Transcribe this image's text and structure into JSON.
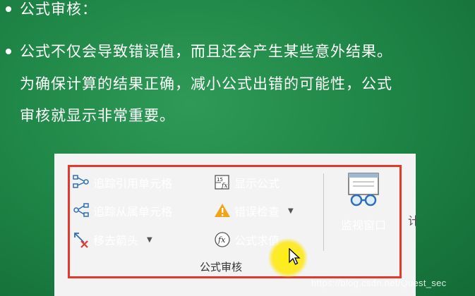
{
  "slide": {
    "bullet1": "公式审核：",
    "bullet2_line1": "公式不仅会导致错误值，而且还会产生某些意外结果。",
    "para_line2": "为确保计算的结果正确，减小公式出错的可能性，公式",
    "para_line3": "审核就显示非常重要。"
  },
  "ribbon": {
    "trace_precedents": "追踪引用单元格",
    "trace_dependents": "追踪从属单元格",
    "remove_arrows": "移去箭头",
    "show_formulas": "显示公式",
    "error_checking": "错误检查",
    "evaluate_formula": "公式求值",
    "group_label": "公式审核",
    "watch_window": "监视窗口",
    "clipped_next": "计"
  },
  "watermark": "https://blog.csdn.net/Quest_sec",
  "colors": {
    "background": "#1f8747",
    "highlight_frame": "#e5382a",
    "cursor_highlight": "#ffe600",
    "arrow_blue": "#2f6fb7",
    "remove_red": "#e03b2e",
    "warning_orange": "#f0a418"
  }
}
